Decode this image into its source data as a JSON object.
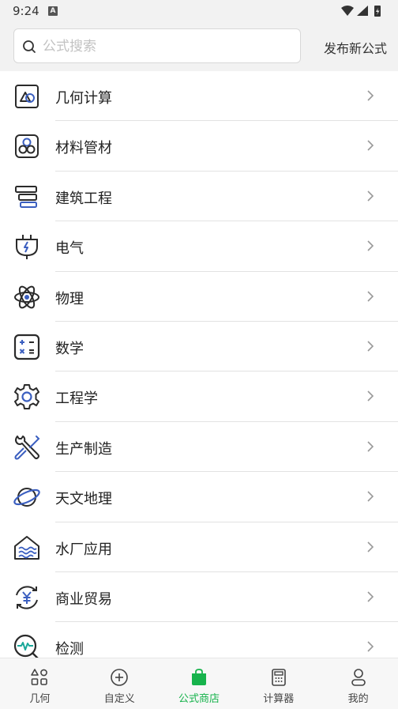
{
  "status_bar": {
    "time": "9:24",
    "notification_badge": "A"
  },
  "header": {
    "search_placeholder": "公式搜索",
    "publish_label": "发布新公式"
  },
  "categories": [
    {
      "label": "几何计算",
      "icon": "geometry-shapes-icon"
    },
    {
      "label": "材料管材",
      "icon": "pipes-circles-icon"
    },
    {
      "label": "建筑工程",
      "icon": "building-blocks-icon"
    },
    {
      "label": "电气",
      "icon": "plug-lightning-icon"
    },
    {
      "label": "物理",
      "icon": "atom-icon"
    },
    {
      "label": "数学",
      "icon": "math-operators-icon"
    },
    {
      "label": "工程学",
      "icon": "gear-icon"
    },
    {
      "label": "生产制造",
      "icon": "tools-icon"
    },
    {
      "label": "天文地理",
      "icon": "planet-icon"
    },
    {
      "label": "水厂应用",
      "icon": "water-plant-icon"
    },
    {
      "label": "商业贸易",
      "icon": "yen-cycle-icon"
    },
    {
      "label": "检测",
      "icon": "pulse-magnifier-icon"
    }
  ],
  "tabs": [
    {
      "label": "几何",
      "icon": "shapes-icon",
      "active": false
    },
    {
      "label": "自定义",
      "icon": "plus-circle-icon",
      "active": false
    },
    {
      "label": "公式商店",
      "icon": "shopping-bag-icon",
      "active": true
    },
    {
      "label": "计算器",
      "icon": "calculator-icon",
      "active": false
    },
    {
      "label": "我的",
      "icon": "person-icon",
      "active": false
    }
  ],
  "colors": {
    "accent": "#17b34c",
    "icon_blue": "#3b5fc0",
    "icon_teal": "#1aa89a",
    "icon_dark": "#2a2a2a"
  }
}
